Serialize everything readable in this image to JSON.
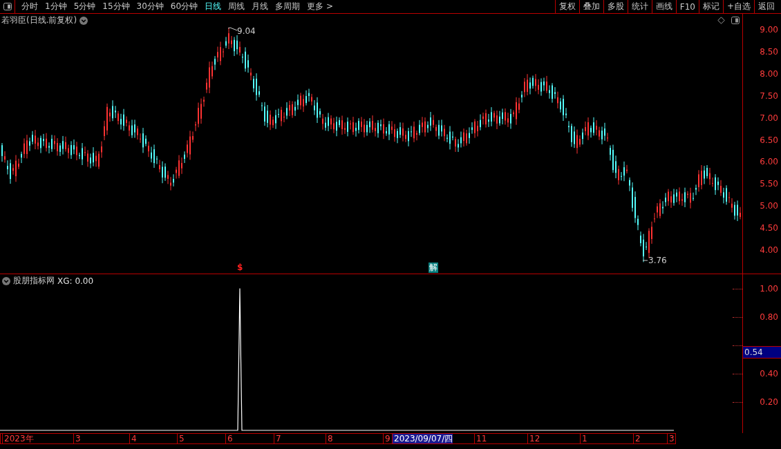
{
  "toolbar": {
    "periods": [
      {
        "label": "分时",
        "selected": false
      },
      {
        "label": "1分钟",
        "selected": false
      },
      {
        "label": "5分钟",
        "selected": false
      },
      {
        "label": "15分钟",
        "selected": false
      },
      {
        "label": "30分钟",
        "selected": false
      },
      {
        "label": "60分钟",
        "selected": false
      },
      {
        "label": "日线",
        "selected": true
      },
      {
        "label": "周线",
        "selected": false
      },
      {
        "label": "月线",
        "selected": false
      },
      {
        "label": "多周期",
        "selected": false
      },
      {
        "label": "更多 >",
        "selected": false
      }
    ],
    "buttons": [
      "复权",
      "叠加",
      "多股",
      "统计",
      "画线",
      "F10",
      "标记",
      "+自选",
      "返回"
    ]
  },
  "main_chart": {
    "title": "若羽臣(日线.前复权)",
    "y_labels": [
      "9.00",
      "8.50",
      "8.00",
      "7.50",
      "7.00",
      "6.50",
      "6.00",
      "5.50",
      "5.00",
      "4.50",
      "4.00"
    ],
    "high_label": "9.04",
    "low_label": "3.76",
    "markers": [
      {
        "kind": "dollar",
        "label": "$"
      },
      {
        "kind": "signal",
        "label": "解"
      }
    ]
  },
  "indicator": {
    "title": "股朋指标网",
    "reading": "XG: 0.00",
    "cursor_value": "0.54",
    "y_labels": [
      "1.00",
      "0.80",
      "0.40",
      "0.20"
    ]
  },
  "date_axis": [
    {
      "label": "2023年",
      "selected": false
    },
    {
      "label": "3",
      "selected": false
    },
    {
      "label": "4",
      "selected": false
    },
    {
      "label": "5",
      "selected": false
    },
    {
      "label": "6",
      "selected": false
    },
    {
      "label": "7",
      "selected": false
    },
    {
      "label": "8",
      "selected": false
    },
    {
      "label": "9",
      "selected": false
    },
    {
      "label": "2023/09/07/四",
      "selected": true
    },
    {
      "label": "11",
      "selected": false
    },
    {
      "label": "12",
      "selected": false
    },
    {
      "label": "1",
      "selected": false
    },
    {
      "label": "2",
      "selected": false
    },
    {
      "label": "3",
      "selected": false
    }
  ]
}
